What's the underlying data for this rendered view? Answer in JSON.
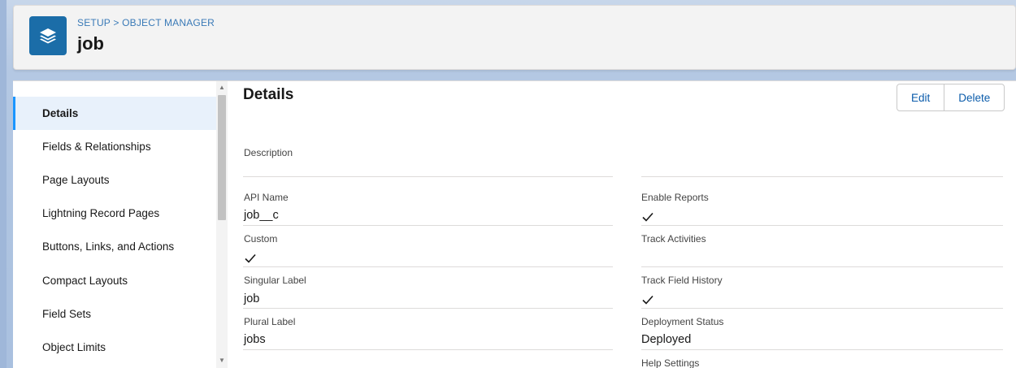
{
  "header": {
    "breadcrumb": [
      "SETUP",
      ">",
      "OBJECT MANAGER"
    ],
    "title": "job",
    "icon": "layers-icon"
  },
  "nav": {
    "items": [
      {
        "label": "Details",
        "active": true
      },
      {
        "label": "Fields & Relationships",
        "active": false
      },
      {
        "label": "Page Layouts",
        "active": false
      },
      {
        "label": "Lightning Record Pages",
        "active": false
      },
      {
        "label": "Buttons, Links, and Actions",
        "active": false
      },
      {
        "label": "Compact Layouts",
        "active": false
      },
      {
        "label": "Field Sets",
        "active": false
      },
      {
        "label": "Object Limits",
        "active": false
      }
    ]
  },
  "details": {
    "title": "Details",
    "edit_label": "Edit",
    "delete_label": "Delete",
    "description_label": "Description",
    "left_fields": [
      {
        "label": "API Name",
        "value": "job__c"
      },
      {
        "label": "Custom",
        "value": "",
        "checked": true
      },
      {
        "label": "Singular Label",
        "value": "job"
      },
      {
        "label": "Plural Label",
        "value": "jobs"
      }
    ],
    "right_fields": [
      {
        "label": "Enable Reports",
        "value": "",
        "checked": true
      },
      {
        "label": "Track Activities",
        "value": "",
        "checked": false
      },
      {
        "label": "Track Field History",
        "value": "",
        "checked": true
      },
      {
        "label": "Deployment Status",
        "value": "Deployed"
      },
      {
        "label": "Help Settings",
        "value": ""
      }
    ]
  },
  "colors": {
    "brand": "#1b6da8",
    "link": "#0b5cab",
    "active_nav": "#e8f1fb"
  }
}
